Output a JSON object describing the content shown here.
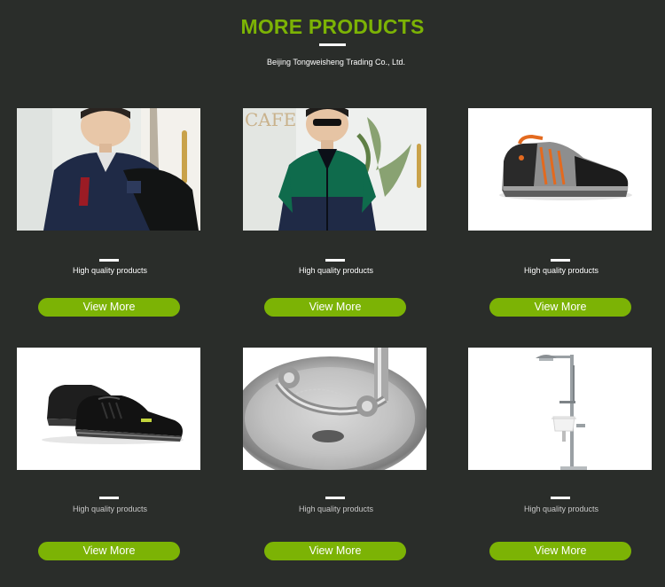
{
  "header": {
    "title": "MORE PRODUCTS",
    "subtitle": "Beijing Tongweisheng Trading Co., Ltd."
  },
  "colors": {
    "background": "#2a2d2a",
    "accent": "#7cb305",
    "text": "#ffffff",
    "muted_caption": "#c8c8c8"
  },
  "products": [
    {
      "image_icon": "workwear-jacket-navy-image",
      "caption": "High quality products",
      "button_label": "View More"
    },
    {
      "image_icon": "workwear-jacket-green-navy-image",
      "caption": "High quality products",
      "button_label": "View More"
    },
    {
      "image_icon": "safety-shoe-orange-image",
      "caption": "High quality products",
      "button_label": "View More"
    },
    {
      "image_icon": "safety-shoes-black-image",
      "caption": "High quality products",
      "button_label": "View More"
    },
    {
      "image_icon": "eyewash-bowl-image",
      "caption": "High quality products",
      "button_label": "View More"
    },
    {
      "image_icon": "emergency-shower-eyewash-image",
      "caption": "High quality products",
      "button_label": "View More"
    }
  ]
}
